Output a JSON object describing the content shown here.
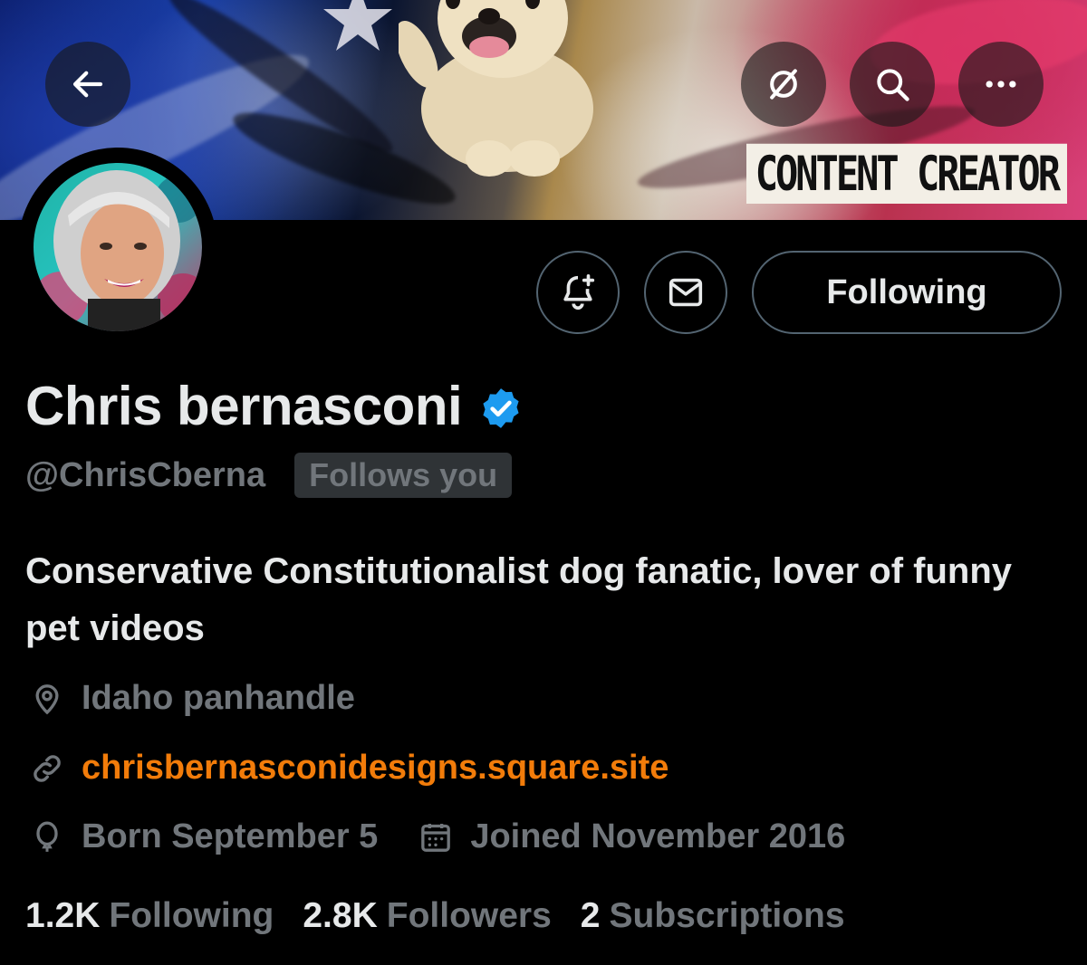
{
  "banner": {
    "label": "CONTENT CREATOR"
  },
  "header_actions": {
    "back_icon": "arrow-left-icon",
    "grok_icon": "grok-slash-circle-icon",
    "search_icon": "search-icon",
    "more_icon": "more-dots-icon"
  },
  "profile": {
    "name": "Chris bernasconi",
    "verified": true,
    "handle": "@ChrisCberna",
    "follows_you": "Follows you",
    "bio": "Conservative Constitutionalist dog fanatic, lover of funny pet videos",
    "location": "Idaho panhandle",
    "website": "chrisbernasconidesigns.square.site",
    "birthday": "Born September 5",
    "joined": "Joined November 2016"
  },
  "buttons": {
    "notify_icon": "bell-plus-icon",
    "message_icon": "envelope-icon",
    "following_label": "Following"
  },
  "stats": {
    "following_count": "1.2K",
    "following_label": "Following",
    "followers_count": "2.8K",
    "followers_label": "Followers",
    "subscriptions_count": "2",
    "subscriptions_label": "Subscriptions"
  },
  "colors": {
    "background": "#000000",
    "text_primary": "#e7e9ea",
    "text_secondary": "#71767b",
    "link": "#f27c0a",
    "verified_badge": "#1d9bf0",
    "button_border": "#536471"
  }
}
